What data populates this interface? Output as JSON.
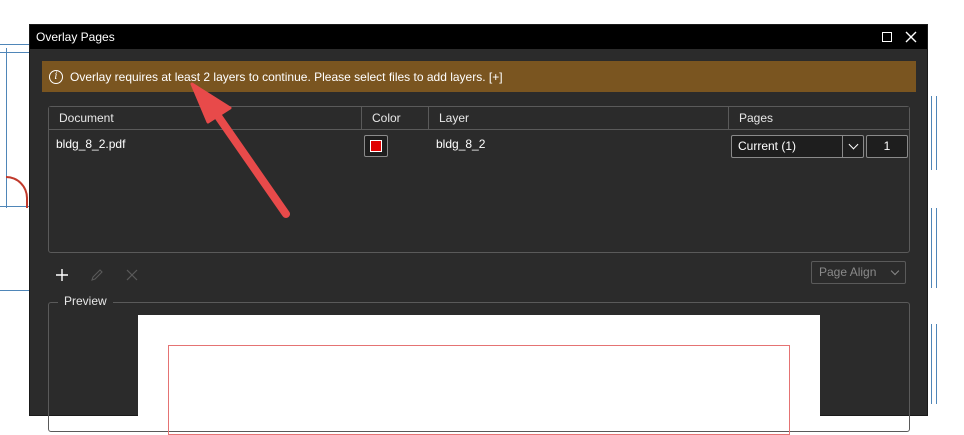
{
  "dialog": {
    "title": "Overlay Pages",
    "maximize_icon": "maximize-icon",
    "close_icon": "close-icon"
  },
  "banner": {
    "icon": "info-icon",
    "text": "Overlay requires at least 2 layers to continue. Please select files to add layers. [+]",
    "color": "#7a5520"
  },
  "table": {
    "headers": [
      "Document",
      "Color",
      "Layer",
      "Pages"
    ],
    "rows": [
      {
        "document": "bldg_8_2.pdf",
        "color": "#e00000",
        "layer": "bldg_8_2",
        "pages_option": "Current (1)",
        "pages_value": "1"
      }
    ]
  },
  "toolbar": {
    "add_icon": "plus-icon",
    "edit_icon": "pencil-icon",
    "remove_icon": "x-icon",
    "page_align_label": "Page Align"
  },
  "preview": {
    "label": "Preview"
  },
  "annotation": {
    "arrow_color": "#e84a4a"
  }
}
